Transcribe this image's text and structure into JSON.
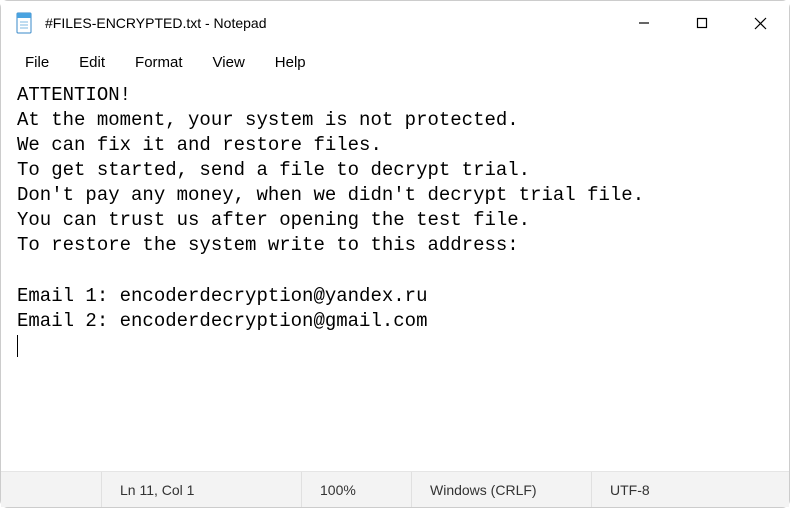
{
  "titlebar": {
    "title": "#FILES-ENCRYPTED.txt - Notepad"
  },
  "menu": {
    "file": "File",
    "edit": "Edit",
    "format": "Format",
    "view": "View",
    "help": "Help"
  },
  "content": {
    "text": "ATTENTION!\nAt the moment, your system is not protected.\nWe can fix it and restore files.\nTo get started, send a file to decrypt trial.\nDon't pay any money, when we didn't decrypt trial file.\nYou can trust us after opening the test file.\nTo restore the system write to this address:\n\nEmail 1: encoderdecryption@yandex.ru\nEmail 2: encoderdecryption@gmail.com"
  },
  "status": {
    "position": "Ln 11, Col 1",
    "zoom": "100%",
    "line_ending": "Windows (CRLF)",
    "encoding": "UTF-8"
  }
}
